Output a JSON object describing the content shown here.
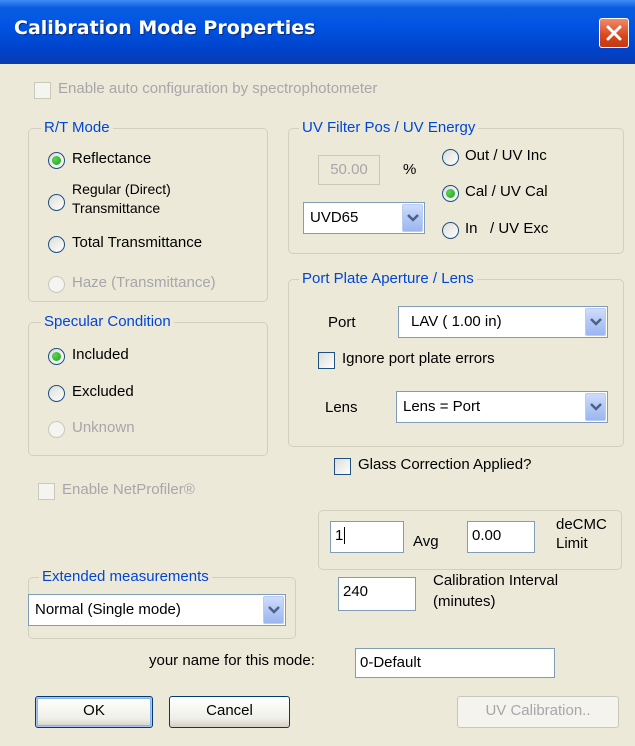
{
  "window": {
    "title": "Calibration Mode Properties",
    "close_icon": "close-icon"
  },
  "auto_config": {
    "label": "Enable auto configuration by spectrophotometer",
    "checked": false,
    "enabled": false
  },
  "rt_mode": {
    "legend": "R/T Mode",
    "options": [
      {
        "label": "Reflectance",
        "selected": true,
        "enabled": true
      },
      {
        "label": "Regular  (Direct)",
        "label2": "Transmittance",
        "selected": false,
        "enabled": true
      },
      {
        "label": "Total Transmittance",
        "selected": false,
        "enabled": true
      },
      {
        "label": "Haze (Transmittance)",
        "selected": false,
        "enabled": false
      }
    ]
  },
  "uv_filter": {
    "legend": "UV Filter Pos / UV Energy",
    "percent_value": "50.00",
    "percent_unit": "%",
    "combo_value": "UVD65",
    "options": [
      {
        "label": "Out / UV Inc",
        "selected": false
      },
      {
        "label": "Cal / UV Cal",
        "selected": true
      },
      {
        "label": "In   / UV Exc",
        "selected": false
      }
    ]
  },
  "specular": {
    "legend": "Specular Condition",
    "options": [
      {
        "label": "Included",
        "selected": true,
        "enabled": true
      },
      {
        "label": "Excluded",
        "selected": false,
        "enabled": true
      },
      {
        "label": "Unknown",
        "selected": false,
        "enabled": false
      }
    ]
  },
  "port_plate": {
    "legend": "Port Plate Aperture / Lens",
    "port_label": "Port",
    "port_value": "LAV ( 1.00 in)",
    "ignore_label": "Ignore port plate errors",
    "ignore_checked": false,
    "lens_label": "Lens",
    "lens_value": "Lens = Port"
  },
  "glass_correction": {
    "label": "Glass Correction Applied?",
    "checked": false
  },
  "netprofiler": {
    "label": "Enable NetProfiler®",
    "checked": false,
    "enabled": false
  },
  "avg": {
    "value": "1",
    "label": "Avg",
    "decmc_value": "0.00",
    "decmc_label1": "deCMC",
    "decmc_label2": "Limit"
  },
  "calibration_interval": {
    "value": "240",
    "label1": "Calibration Interval",
    "label2": "(minutes)"
  },
  "extended": {
    "legend": "Extended measurements",
    "value": "Normal (Single mode)"
  },
  "mode_name": {
    "label": "your name for this mode:",
    "value": "0-Default"
  },
  "buttons": {
    "ok": "OK",
    "cancel": "Cancel",
    "uv_calibration": "UV Calibration.."
  }
}
